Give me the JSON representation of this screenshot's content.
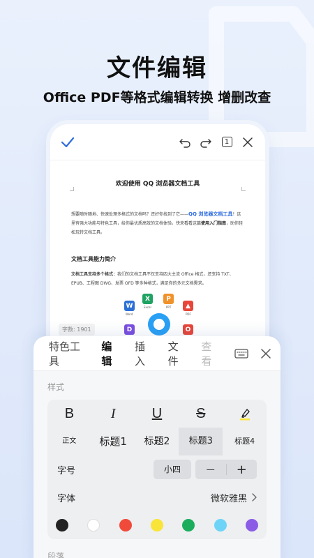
{
  "promo": {
    "title": "文件编辑",
    "subtitle": "Office PDF等格式编辑转换 增删改查"
  },
  "phone": {
    "page_number": "1",
    "doc": {
      "title": "欢迎使用 QQ 浏览器文档工具",
      "intro_a": "想要随时随地、快速处理多格式的文档吗？还好你找到了它——",
      "intro_link": "QQ 浏览器文档工具",
      "intro_b": "！这里有强大功能与特色工具，给你最优质高效的文档体验。快来看看这篇",
      "intro_bold": "使用入门指南",
      "intro_c": "，助你轻松玩转文档工具。",
      "section_title": "文档工具能力简介",
      "support_bold": "文档工具支持多个格式：",
      "support_text": "我们的文档工具不仅支持四大主流 Office 格式，还支持 TXT、EPUB、工程图 DWG、发票 OFD 等多种格式，满足你的多元文档需求。",
      "logo_word": "Word",
      "logo_excel": "Excel",
      "logo_ppt": "PPT",
      "logo_pdf": "PDF"
    },
    "word_count": "字数: 1901"
  },
  "sheet": {
    "tabs": [
      "特色工具",
      "编辑",
      "插入",
      "文件",
      "查看"
    ],
    "active_tab": "编辑",
    "style_label": "样式",
    "format_buttons": [
      "B",
      "I",
      "U",
      "S"
    ],
    "headings": [
      "正文",
      "标题1",
      "标题2",
      "标题3",
      "标题4"
    ],
    "selected_heading": "标题3",
    "font_size_label": "字号",
    "font_size_value": "小四",
    "minus": "—",
    "plus": "+",
    "font_label": "字体",
    "font_value": "微软雅黑",
    "colors": [
      "#222222",
      "#ffffff",
      "#f04a3a",
      "#f9e43a",
      "#1aae5c",
      "#6dd4f7",
      "#8b5ce6"
    ],
    "paragraph_label": "段落"
  }
}
